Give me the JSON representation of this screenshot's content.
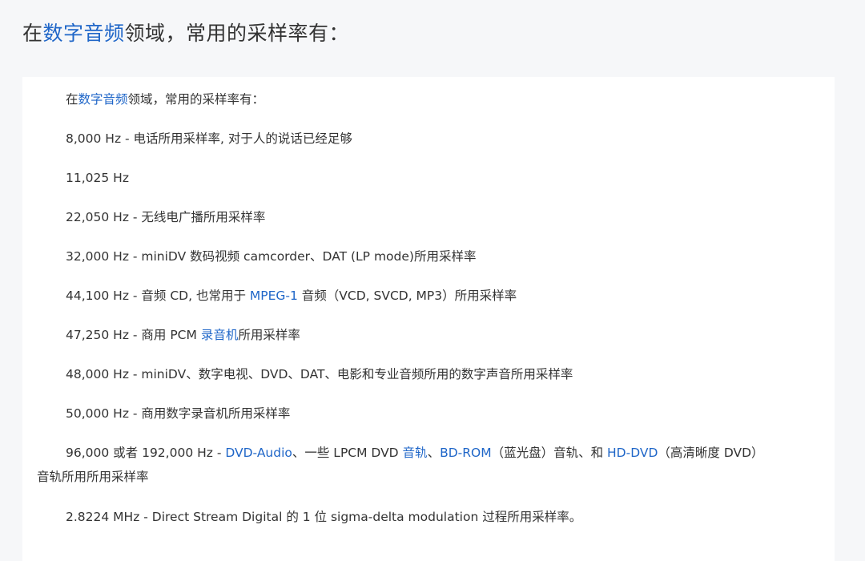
{
  "heading": {
    "prefix": "在",
    "link": "数字音频",
    "suffix": "领域，常用的采样率有："
  },
  "article": {
    "intro": {
      "prefix": "在",
      "link": "数字音频",
      "suffix": "领域，常用的采样率有："
    },
    "items": [
      {
        "text": "8,000 Hz - 电话所用采样率, 对于人的说话已经足够"
      },
      {
        "text": "11,025 Hz"
      },
      {
        "text": "22,050 Hz - 无线电广播所用采样率"
      },
      {
        "text": "32,000 Hz - miniDV 数码视频 camcorder、DAT (LP mode)所用采样率"
      },
      {
        "p1": "44,100 Hz - 音频 CD, 也常用于 ",
        "link1": "MPEG-1",
        "p2": " 音频（VCD, SVCD, MP3）所用采样率"
      },
      {
        "p1": "47,250 Hz - 商用 PCM ",
        "link1": "录音机",
        "p2": "所用采样率"
      },
      {
        "text": "48,000 Hz - miniDV、数字电视、DVD、DAT、电影和专业音频所用的数字声音所用采样率"
      },
      {
        "text": "50,000 Hz - 商用数字录音机所用采样率"
      },
      {
        "p1": "96,000 或者 192,000 Hz - ",
        "link1": "DVD-Audio",
        "p2": "、一些 LPCM DVD ",
        "link2": "音轨",
        "p3": "、",
        "link3": "BD-ROM",
        "p4": "（蓝光盘）音轨、和 ",
        "link4": "HD-DVD",
        "p5": "（高清晰度 DVD）",
        "cont": "音轨所用所用采样率"
      },
      {
        "text": "2.8224 MHz - Direct Stream Digital 的 1 位 sigma-delta modulation 过程所用采样率。"
      }
    ]
  },
  "colors": {
    "link": "#1f66c8",
    "text": "#333333",
    "background": "#f6f7f9",
    "card": "#ffffff"
  }
}
